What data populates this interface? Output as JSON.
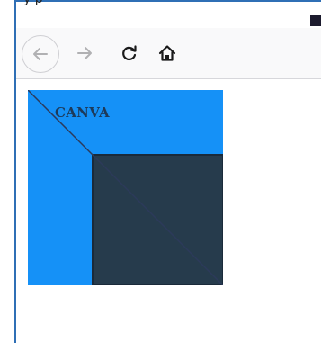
{
  "window": {
    "title_fragment": "y   p"
  },
  "toolbar": {
    "back_icon": "arrow-left-icon",
    "forward_icon": "arrow-right-icon",
    "reload_icon": "reload-icon",
    "home_icon": "home-icon"
  },
  "canvas": {
    "text": "CANVA",
    "colors": {
      "blue": "#1591f7",
      "dark": "#263b4c",
      "line": "#2c3a5a",
      "text": "#1d3a5a"
    }
  }
}
